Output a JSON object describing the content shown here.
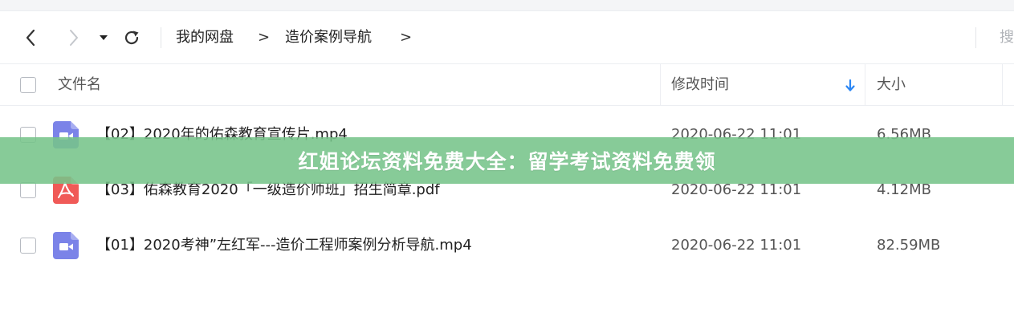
{
  "toolbar": {
    "back_icon": "chevron-left-icon",
    "forward_icon": "chevron-right-icon",
    "history_dropdown_icon": "caret-down-icon",
    "refresh_icon": "refresh-icon",
    "breadcrumb": [
      {
        "label": "我的网盘"
      },
      {
        "label": "造价案例导航"
      }
    ],
    "breadcrumb_separator": ">",
    "search_stub": "搜"
  },
  "table": {
    "columns": {
      "name": "文件名",
      "modified": "修改时间",
      "size": "大小"
    },
    "sort_icon": "sort-desc-arrow-icon",
    "rows": [
      {
        "name": "【02】2020年的佑森教育宣传片.mp4",
        "modified": "2020-06-22 11:01",
        "size": "6.56MB",
        "type": "video",
        "icon": "video-file-icon"
      },
      {
        "name": "【03】佑森教育2020「一级造价师班」招生简章.pdf",
        "modified": "2020-06-22 11:01",
        "size": "4.12MB",
        "type": "pdf",
        "icon": "pdf-file-icon"
      },
      {
        "name": "【01】2020考神”左红军---造价工程师案例分析导航.mp4",
        "modified": "2020-06-22 11:01",
        "size": "82.59MB",
        "type": "video",
        "icon": "video-file-icon"
      }
    ]
  },
  "overlay_banner": {
    "text": "红姐论坛资料免费大全：留学考试资料免费领"
  },
  "colors": {
    "video_icon": "#7b83e8",
    "pdf_icon": "#f05a57",
    "banner": "#76c48a",
    "sort_arrow": "#2b86f4"
  }
}
